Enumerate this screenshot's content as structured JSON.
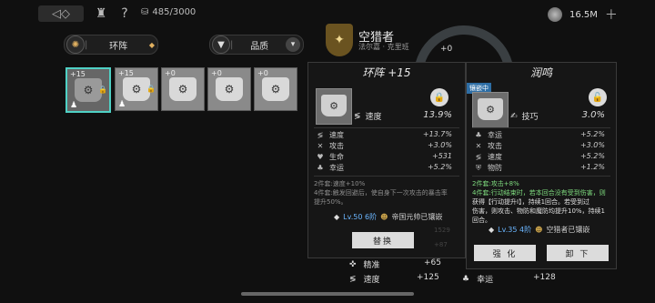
{
  "topbar": {
    "capacity": "485/3000",
    "currency": "16.5M",
    "back_icon": "back-arrow-icon",
    "help": "?"
  },
  "filters": {
    "category": "环阵",
    "quality": "品质"
  },
  "slots": [
    {
      "level": "+15",
      "selected": true
    },
    {
      "level": "+15",
      "selected": false
    },
    {
      "level": "+0",
      "selected": false
    },
    {
      "level": "+0",
      "selected": false
    },
    {
      "level": "+0",
      "selected": false
    }
  ],
  "character": {
    "name": "空猎者",
    "subtitle": "法尔嘉 · 克里班",
    "plus_left": "+0",
    "plus_right": "+0"
  },
  "left_panel": {
    "title": "环阵 +15",
    "main_stat": {
      "label": "速度",
      "value": "13.9%"
    },
    "substats": [
      {
        "icon": "speed-icon",
        "label": "速度",
        "value": "+13.7%"
      },
      {
        "icon": "attack-icon",
        "label": "攻击",
        "value": "+3.0%"
      },
      {
        "icon": "heart-icon",
        "label": "生命",
        "value": "+531"
      },
      {
        "icon": "clover-icon",
        "label": "幸运",
        "value": "+5.2%"
      }
    ],
    "set_line1": "2件套:速度+10%",
    "set_line2": "4件套:触发回避后，使自身下一次攻击的暴击率",
    "set_line3": "提升50%。",
    "engraved_level": "Lv.50 6阶",
    "engraved_by": "帝国元帅已镶嵌",
    "button": "替换",
    "faint1": "1529",
    "faint2": "+87"
  },
  "right_panel": {
    "title": "润鸣",
    "tag": "镶嵌中",
    "main_stat": {
      "label": "技巧",
      "value": "3.0%"
    },
    "substats": [
      {
        "icon": "clover-icon",
        "label": "幸运",
        "value": "+5.2%"
      },
      {
        "icon": "attack-icon",
        "label": "攻击",
        "value": "+3.0%"
      },
      {
        "icon": "speed-icon",
        "label": "速度",
        "value": "+5.2%"
      },
      {
        "icon": "shield-icon",
        "label": "物防",
        "value": "+1.2%"
      }
    ],
    "set_line1": "2件套:攻击+8%",
    "set_line2": "4件套:行动结束时，若本回合没有受到伤害，则",
    "set_line3": "获得【行动提升Ⅰ】，持续1回合。若受到过",
    "set_line4": "伤害，则攻击、物防和魔防均提升10%，持续1",
    "set_line5": "回合。",
    "engraved_level": "Lv.35 4阶",
    "engraved_by": "空猎者已镶嵌",
    "button_enhance": "强 化",
    "button_unequip": "卸 下"
  },
  "bottom_stats": [
    {
      "label": "精准",
      "value": "+65"
    },
    {
      "label": "速度",
      "value": "+125"
    },
    {
      "label": "幸运",
      "value": "+128"
    }
  ]
}
